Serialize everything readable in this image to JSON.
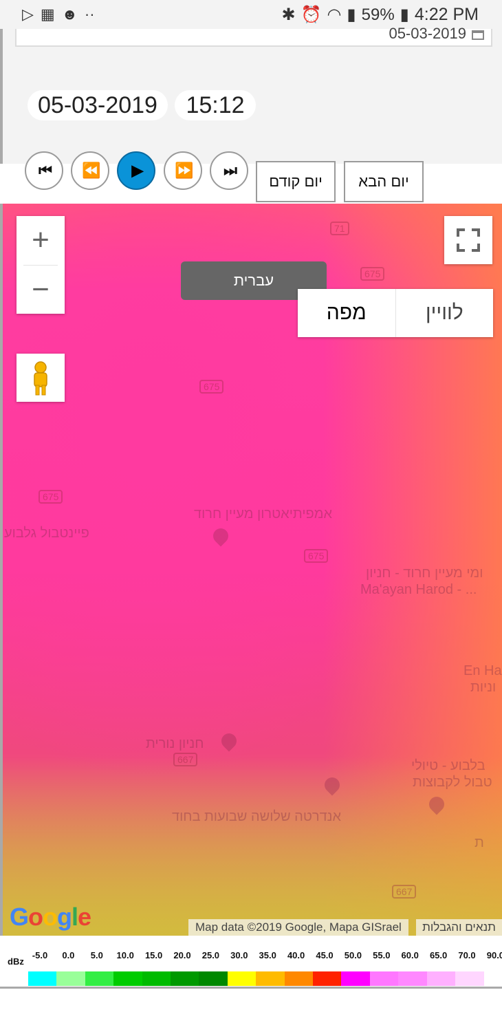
{
  "status_bar": {
    "battery": "59%",
    "time": "4:22 PM",
    "left_icons": [
      "play-store-icon",
      "calendar-icon",
      "chat-icon",
      "more-dots-icon"
    ],
    "right_icons": [
      "bluetooth-icon",
      "alarm-icon",
      "wifi-icon",
      "signal-icon",
      "battery-icon"
    ]
  },
  "date_input": {
    "value": "05-03-2019"
  },
  "selected": {
    "date": "05-03-2019",
    "time": "15:12"
  },
  "playback": {
    "first": "⏮",
    "back": "⏪",
    "play": "▶",
    "forward": "⏩",
    "last": "⏭"
  },
  "day_nav": {
    "prev_day": "יום קודם",
    "next_day": "יום הבא"
  },
  "map": {
    "tooltip": "עברית",
    "map_type": {
      "map": "מפה",
      "satellite": "לוויין"
    },
    "zoom_in": "+",
    "zoom_out": "−",
    "labels": [
      "אמפיתיאטרון מעיין חרוד",
      "פיינטבול גלבוע",
      "ומי מעיין חרוד - חניון",
      "Ma'ayan Harod - ...",
      "חניון נורית",
      "אנדרטה שלושה שבועות בחוד",
      "בלבוע - טיולי",
      "טבול לקבוצות",
      "En Har",
      "וניות",
      "ת"
    ],
    "road_numbers": [
      "71",
      "675",
      "675",
      "675",
      "675",
      "667",
      "667"
    ],
    "attribution": "Map data ©2019 Google, Mapa GISrael",
    "terms": "תנאים והגבלות",
    "google_logo": "Google"
  },
  "legend": {
    "unit": "dBz",
    "values": [
      "-5.0",
      "0.0",
      "5.0",
      "10.0",
      "15.0",
      "20.0",
      "25.0",
      "30.0",
      "35.0",
      "40.0",
      "45.0",
      "50.0",
      "55.0",
      "60.0",
      "65.0",
      "70.0",
      "90.0"
    ],
    "colors": [
      "#00ffff",
      "#99ff99",
      "#33ee44",
      "#00cc00",
      "#00bb00",
      "#009900",
      "#008800",
      "#ffff00",
      "#ffbb00",
      "#ff8800",
      "#ff2200",
      "#ff00ff",
      "#ff77ff",
      "#ff88ff",
      "#ffb0ff",
      "#ffd6ff"
    ]
  }
}
